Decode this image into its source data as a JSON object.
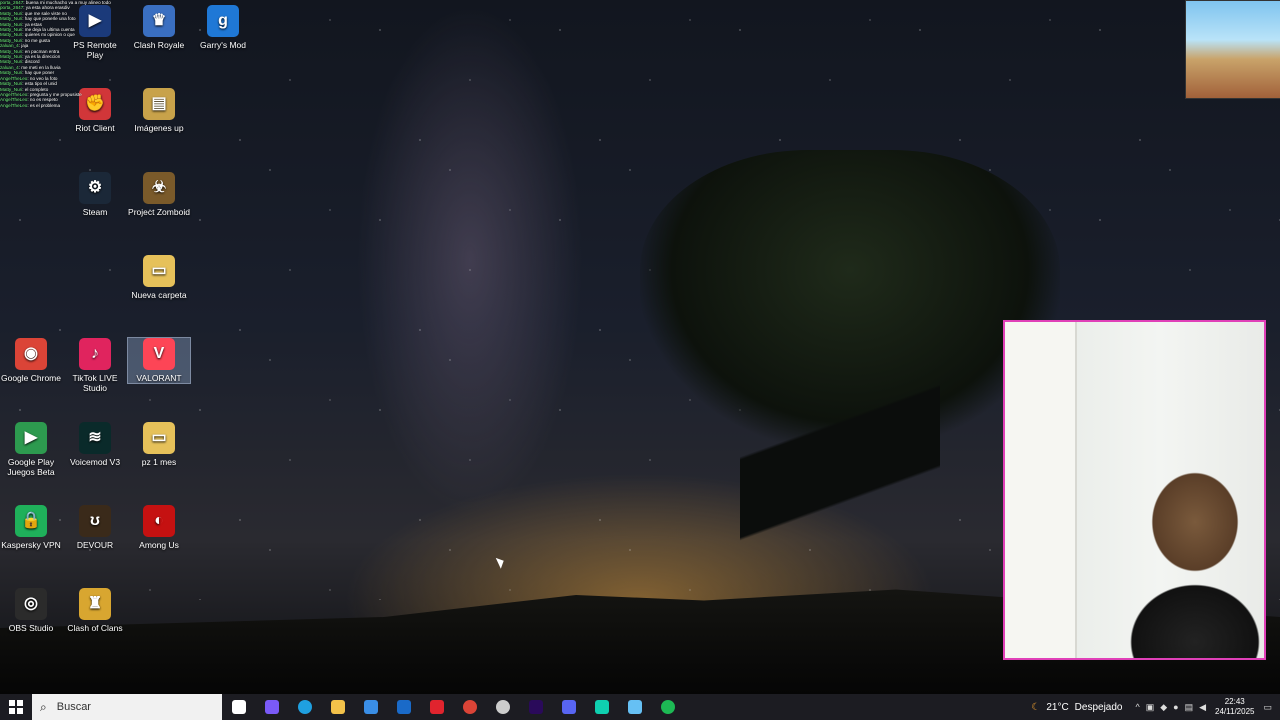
{
  "desktop_icons": [
    {
      "label": "PS Remote Play",
      "icon": "ps-remote-play-icon",
      "color": "#1b3a7a",
      "glyph": "▶"
    },
    {
      "label": "Clash Royale",
      "icon": "clash-royale-icon",
      "color": "#3a6fc1",
      "glyph": "♛"
    },
    {
      "label": "Garry's Mod",
      "icon": "garrys-mod-icon",
      "color": "#1f78d6",
      "glyph": "g"
    },
    {
      "label": "Riot Client",
      "icon": "riot-client-icon",
      "color": "#d13639",
      "glyph": "✊"
    },
    {
      "label": "Imágenes up",
      "icon": "folder-images-icon",
      "color": "#c8a24a",
      "glyph": "▤"
    },
    {
      "label": "Steam",
      "icon": "steam-icon",
      "color": "#1b2838",
      "glyph": "⚙"
    },
    {
      "label": "Project Zomboid",
      "icon": "project-zomboid-icon",
      "color": "#7a5a2a",
      "glyph": "☣"
    },
    {
      "label": "Nueva carpeta",
      "icon": "folder-icon",
      "color": "#e6c15a",
      "glyph": "▭"
    },
    {
      "label": "Google Chrome",
      "icon": "chrome-icon",
      "color": "#db4437",
      "glyph": "◉"
    },
    {
      "label": "TikTok LIVE Studio",
      "icon": "tiktok-live-icon",
      "color": "#e0245e",
      "glyph": "♪"
    },
    {
      "label": "VALORANT",
      "icon": "valorant-icon",
      "color": "#fd4556",
      "glyph": "V"
    },
    {
      "label": "Google Play Juegos Beta",
      "icon": "google-play-games-icon",
      "color": "#2d9a4f",
      "glyph": "▶"
    },
    {
      "label": "Voicemod V3",
      "icon": "voicemod-icon",
      "color": "#0a2a2a",
      "glyph": "≋"
    },
    {
      "label": "pz 1 mes",
      "icon": "folder-icon",
      "color": "#e6c15a",
      "glyph": "▭"
    },
    {
      "label": "Kaspersky VPN",
      "icon": "kaspersky-vpn-icon",
      "color": "#1fb05a",
      "glyph": "🔒"
    },
    {
      "label": "DEVOUR",
      "icon": "devour-icon",
      "color": "#3a2a1a",
      "glyph": "ʊ"
    },
    {
      "label": "Among Us",
      "icon": "among-us-icon",
      "color": "#c51111",
      "glyph": "◐"
    },
    {
      "label": "OBS Studio",
      "icon": "obs-studio-icon",
      "color": "#2b2b2b",
      "glyph": "◎"
    },
    {
      "label": "Clash of Clans",
      "icon": "clash-of-clans-icon",
      "color": "#d8a630",
      "glyph": "♜"
    }
  ],
  "chat": [
    {
      "user": "porta_2647",
      "text": ": buena mi muchacho va a muy alineo todo"
    },
    {
      "user": "porta_2647",
      "text": ": ya esta ahora erasdiv"
    },
    {
      "user": "Matty_Nuri",
      "text": ": que me sale viste no"
    },
    {
      "user": "Matty_Nuri",
      "text": ": hay que ponerle una foto"
    },
    {
      "user": "Matty_Nuri",
      "text": ": ya estas"
    },
    {
      "user": "Matty_Nuri",
      "text": ": me deja la ultima cuenta"
    },
    {
      "user": "Matty_Nuri",
      "text": ": quieres mi opinion o que"
    },
    {
      "user": "Matty_Nuri",
      "text": ": no me gusta"
    },
    {
      "user": "zaluan_4",
      "text": ": jaja"
    },
    {
      "user": "Matty_Nuri",
      "text": ": en pacman entra"
    },
    {
      "user": "Matty_Nuri",
      "text": ": ya es la direccion"
    },
    {
      "user": "Matty_Nuri",
      "text": ": discord"
    },
    {
      "user": "zaluan_4",
      "text": ": me meti en la lluvia"
    },
    {
      "user": "Matty_Nuri",
      "text": ": hay que poner"
    },
    {
      "user": "AngelTheLeo",
      "text": ": no veo la foto"
    },
    {
      "user": "Matty_Nuri",
      "text": ": esta tipo el unid"
    },
    {
      "user": "Matty_Nuri",
      "text": ": el completo"
    },
    {
      "user": "AngelTheLeo",
      "text": ": pregunta y me propusiste"
    },
    {
      "user": "AngelTheLeo",
      "text": ": no es respeto"
    },
    {
      "user": "AngelTheLeo",
      "text": ": es el problema"
    }
  ],
  "taskbar": {
    "search_placeholder": "Buscar",
    "apps": [
      {
        "icon": "task-view-icon",
        "color": "#ffffff"
      },
      {
        "icon": "copilot-icon",
        "color": "#7a5af8"
      },
      {
        "icon": "edge-icon",
        "color": "#1fa0e0"
      },
      {
        "icon": "file-explorer-icon",
        "color": "#f2c14a"
      },
      {
        "icon": "store-icon",
        "color": "#3a8ee6"
      },
      {
        "icon": "outlook-icon",
        "color": "#1a6ac8"
      },
      {
        "icon": "recording-icon",
        "color": "#e0242e"
      },
      {
        "icon": "chrome-icon",
        "color": "#db4437"
      },
      {
        "icon": "obs-icon",
        "color": "#cccccc"
      },
      {
        "icon": "premiere-icon",
        "color": "#2a0a5a"
      },
      {
        "icon": "discord-icon",
        "color": "#5865f2"
      },
      {
        "icon": "voicemod-icon",
        "color": "#0fd0b0"
      },
      {
        "icon": "steam-icon",
        "color": "#66c0f4"
      },
      {
        "icon": "spotify-icon",
        "color": "#1db954"
      }
    ],
    "weather": {
      "temp": "21°C",
      "condition": "Despejado"
    },
    "time": "22:43",
    "date": "24/11/2025"
  }
}
